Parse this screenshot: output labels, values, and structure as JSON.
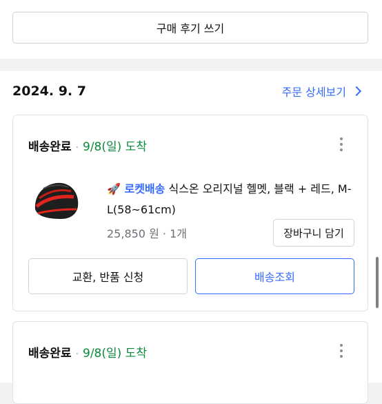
{
  "review_button": "구매 후기 쓰기",
  "order": {
    "date": "2024. 9. 7",
    "detail_link": "주문 상세보기"
  },
  "cards": [
    {
      "status": "배송완료",
      "separator": "·",
      "arrival": "9/8(일) 도착",
      "product": {
        "badge": "🚀 로켓배송",
        "name": "식스온 오리지널 헬멧, 블랙 + 레드, M-L(58~61cm)",
        "price": "25,850 원",
        "price_separator": "·",
        "quantity": "1개"
      },
      "cart_button": "장바구니 담기",
      "exchange_button": "교환, 반품 신청",
      "track_button": "배송조회"
    },
    {
      "status": "배송완료",
      "separator": "·",
      "arrival": "9/8(일) 도착"
    }
  ],
  "colors": {
    "accent": "#346aff",
    "status_green": "#0a8a3a",
    "border": "#cfd3d8",
    "background": "#f1f2f4"
  },
  "icons": [
    "rocket-icon",
    "kebab-menu-icon",
    "chevron-right-icon"
  ]
}
